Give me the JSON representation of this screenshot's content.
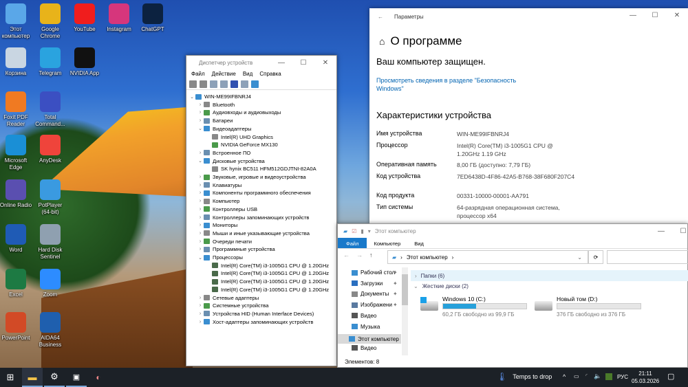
{
  "desktop": {
    "icons": [
      {
        "label": "Этот компьютер",
        "icon": "this-pc-icon",
        "color": "#5aa7e8"
      },
      {
        "label": "Корзина",
        "icon": "recycle-bin-icon",
        "color": "#c9d6e2"
      },
      {
        "label": "Foxit PDF Reader",
        "icon": "foxit-icon",
        "color": "#f07a22"
      },
      {
        "label": "Microsoft Edge",
        "icon": "edge-icon",
        "color": "#1a8fd6"
      },
      {
        "label": "Online Radio",
        "icon": "radio-icon",
        "color": "#5a4fb0"
      },
      {
        "label": "Word",
        "icon": "word-icon",
        "color": "#1f5bb5"
      },
      {
        "label": "Excel",
        "icon": "excel-icon",
        "color": "#1d7a43"
      },
      {
        "label": "PowerPoint",
        "icon": "powerpoint-icon",
        "color": "#d24a26"
      },
      {
        "label": "Google Chrome",
        "icon": "chrome-icon",
        "color": "#e8b31a"
      },
      {
        "label": "Telegram",
        "icon": "telegram-icon",
        "color": "#2aa3df"
      },
      {
        "label": "Total Command...",
        "icon": "total-commander-icon",
        "color": "#3b4fc2"
      },
      {
        "label": "AnyDesk",
        "icon": "anydesk-icon",
        "color": "#ef443b"
      },
      {
        "label": "PotPlayer (64-bit)",
        "icon": "potplayer-icon",
        "color": "#3a9ae0"
      },
      {
        "label": "Hard Disk Sentinel",
        "icon": "hdd-sentinel-icon",
        "color": "#8fa0b0"
      },
      {
        "label": "Zoom",
        "icon": "zoom-icon",
        "color": "#2d8cff"
      },
      {
        "label": "AIDA64 Business",
        "icon": "aida64-icon",
        "color": "#1f5fae"
      },
      {
        "label": "YouTube",
        "icon": "youtube-icon",
        "color": "#f01d1d"
      },
      {
        "label": "NVIDIA App",
        "icon": "nvidia-icon",
        "color": "#111111"
      },
      {
        "label": "Instagram",
        "icon": "instagram-icon",
        "color": "#d6367c"
      },
      {
        "label": "ChatGPT",
        "icon": "chatgpt-icon",
        "color": "#0c2240"
      }
    ]
  },
  "device_manager": {
    "title": "Диспетчер устройств",
    "menu": [
      "Файл",
      "Действие",
      "Вид",
      "Справка"
    ],
    "tree": [
      {
        "label": "WIN-ME99IFBNRJ4",
        "level": 0,
        "state": "open"
      },
      {
        "label": "Bluetooth",
        "level": 1,
        "state": "closed"
      },
      {
        "label": "Аудиовходы и аудиовыходы",
        "level": 1,
        "state": "closed"
      },
      {
        "label": "Батареи",
        "level": 1,
        "state": "closed"
      },
      {
        "label": "Видеоадаптеры",
        "level": 1,
        "state": "open"
      },
      {
        "label": "Intel(R) UHD Graphics",
        "level": 2,
        "state": "leaf"
      },
      {
        "label": "NVIDIA GeForce MX130",
        "level": 2,
        "state": "leaf"
      },
      {
        "label": "Встроенное ПО",
        "level": 1,
        "state": "closed"
      },
      {
        "label": "Дисковые устройства",
        "level": 1,
        "state": "open"
      },
      {
        "label": "SK hynix BC511 HFM512GDJTNI-82A0A",
        "level": 2,
        "state": "leaf"
      },
      {
        "label": "Звуковые, игровые и видеоустройства",
        "level": 1,
        "state": "closed"
      },
      {
        "label": "Клавиатуры",
        "level": 1,
        "state": "closed"
      },
      {
        "label": "Компоненты программного обеспечения",
        "level": 1,
        "state": "closed"
      },
      {
        "label": "Компьютер",
        "level": 1,
        "state": "closed"
      },
      {
        "label": "Контроллеры USB",
        "level": 1,
        "state": "closed"
      },
      {
        "label": "Контроллеры запоминающих устройств",
        "level": 1,
        "state": "closed"
      },
      {
        "label": "Мониторы",
        "level": 1,
        "state": "closed"
      },
      {
        "label": "Мыши и иные указывающие устройства",
        "level": 1,
        "state": "closed"
      },
      {
        "label": "Очереди печати",
        "level": 1,
        "state": "closed"
      },
      {
        "label": "Программные устройства",
        "level": 1,
        "state": "closed"
      },
      {
        "label": "Процессоры",
        "level": 1,
        "state": "open"
      },
      {
        "label": "Intel(R) Core(TM) i3-1005G1 CPU @ 1.20GHz",
        "level": 2,
        "state": "leaf"
      },
      {
        "label": "Intel(R) Core(TM) i3-1005G1 CPU @ 1.20GHz",
        "level": 2,
        "state": "leaf"
      },
      {
        "label": "Intel(R) Core(TM) i3-1005G1 CPU @ 1.20GHz",
        "level": 2,
        "state": "leaf"
      },
      {
        "label": "Intel(R) Core(TM) i3-1005G1 CPU @ 1.20GHz",
        "level": 2,
        "state": "leaf"
      },
      {
        "label": "Сетевые адаптеры",
        "level": 1,
        "state": "closed"
      },
      {
        "label": "Системные устройства",
        "level": 1,
        "state": "closed"
      },
      {
        "label": "Устройства HID (Human Interface Devices)",
        "level": 1,
        "state": "closed"
      },
      {
        "label": "Хост-адаптеры запоминающих устройств",
        "level": 1,
        "state": "closed"
      }
    ]
  },
  "settings": {
    "window_title": "Параметры",
    "page_title": "О программе",
    "protected": "Ваш компьютер защищен.",
    "security_link": "Просмотреть сведения в разделе \"Безопасность Windows\"",
    "section_title": "Характеристики устройства",
    "specs": [
      {
        "label": "Имя устройства",
        "value": "WIN-ME99IFBNRJ4"
      },
      {
        "label": "Процессор",
        "value": "Intel(R) Core(TM) i3-1005G1 CPU @ 1.20GHz   1.19 GHz"
      },
      {
        "label": "Оперативная память",
        "value": "8,00 ГБ (доступно: 7,79 ГБ)"
      },
      {
        "label": "Код устройства",
        "value": "7ED6438D-4F86-42A5-B768-38F680F207C4"
      },
      {
        "label": "Код продукта",
        "value": "00331-10000-00001-AA791"
      },
      {
        "label": "Тип системы",
        "value": "64-разрядная операционная система, процессор x64"
      }
    ],
    "accent": "#0063b1"
  },
  "explorer": {
    "title": "Этот компьютер",
    "tabs": [
      "Файл",
      "Компьютер",
      "Вид"
    ],
    "address": "Этот компьютер",
    "nav": [
      {
        "label": "Рабочий стол",
        "pinned": true
      },
      {
        "label": "Загрузки",
        "pinned": true
      },
      {
        "label": "Документы",
        "pinned": true
      },
      {
        "label": "Изображени",
        "pinned": true
      },
      {
        "label": "Видео",
        "pinned": false
      },
      {
        "label": "Музыка",
        "pinned": false
      },
      {
        "label": "Этот компьютер",
        "pinned": false,
        "selected": true
      },
      {
        "label": "Видео",
        "pinned": false
      }
    ],
    "folders_group": "Папки (6)",
    "drives_group": "Жесткие диски (2)",
    "drives": [
      {
        "name": "Windows 10 (C:)",
        "free": "60,2 ГБ свободно из 99,9 ГБ",
        "used_fraction": 0.397
      },
      {
        "name": "Новый том (D:)",
        "free": "376 ГБ свободно из 376 ГБ",
        "used_fraction": 0.0
      }
    ],
    "status": "Элементов: 8",
    "bar_color": "#26a0da"
  },
  "taskbar": {
    "weather": "Temps to drop",
    "language": "РУС",
    "time": "21:11",
    "date": "05.03.2026"
  }
}
